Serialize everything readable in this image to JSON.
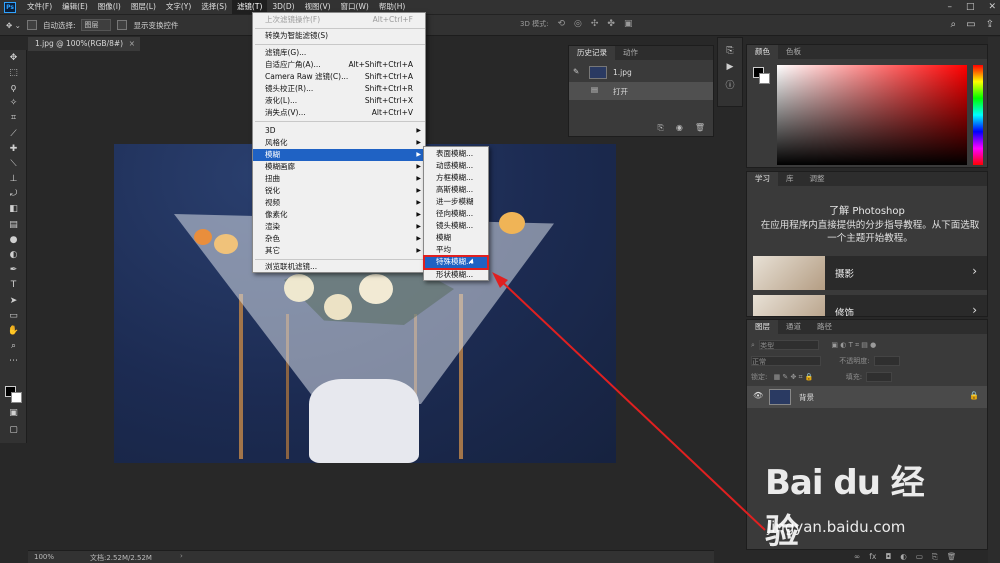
{
  "menubar": {
    "logo": "Ps",
    "items": [
      "文件(F)",
      "编辑(E)",
      "图像(I)",
      "图层(L)",
      "文字(Y)",
      "选择(S)",
      "滤镜(T)",
      "3D(D)",
      "视图(V)",
      "窗口(W)",
      "帮助(H)"
    ],
    "active_index": 6
  },
  "options_bar": {
    "auto_select_label": "自动选择:",
    "auto_select_value": "图层",
    "show_transform_label": "显示变换控件",
    "mode_3d_label": "3D 模式:"
  },
  "document_tab": {
    "title": "1.jpg @ 100%(RGB/8#)",
    "close": "×"
  },
  "filter_menu": {
    "items": [
      {
        "label": "上次滤镜操作(F)",
        "shortcut": "Alt+Ctrl+F",
        "disabled": true
      },
      {
        "label": "转换为智能滤镜(S)",
        "shortcut": ""
      },
      {
        "label": "滤镜库(G)...",
        "shortcut": ""
      },
      {
        "label": "自适应广角(A)...",
        "shortcut": "Alt+Shift+Ctrl+A"
      },
      {
        "label": "Camera Raw 滤镜(C)...",
        "shortcut": "Shift+Ctrl+A"
      },
      {
        "label": "镜头校正(R)...",
        "shortcut": "Shift+Ctrl+R"
      },
      {
        "label": "液化(L)...",
        "shortcut": "Shift+Ctrl+X"
      },
      {
        "label": "消失点(V)...",
        "shortcut": "Alt+Ctrl+V"
      },
      {
        "label": "3D",
        "submenu": true
      },
      {
        "label": "风格化",
        "submenu": true
      },
      {
        "label": "模糊",
        "submenu": true,
        "highlighted": true
      },
      {
        "label": "模糊画廊",
        "submenu": true
      },
      {
        "label": "扭曲",
        "submenu": true
      },
      {
        "label": "锐化",
        "submenu": true
      },
      {
        "label": "视频",
        "submenu": true
      },
      {
        "label": "像素化",
        "submenu": true
      },
      {
        "label": "渲染",
        "submenu": true
      },
      {
        "label": "杂色",
        "submenu": true
      },
      {
        "label": "其它",
        "submenu": true
      },
      {
        "label": "浏览联机滤镜...",
        "shortcut": ""
      }
    ]
  },
  "blur_submenu": {
    "items": [
      "表面模糊...",
      "动感模糊...",
      "方框模糊...",
      "高斯模糊...",
      "进一步模糊",
      "径向模糊...",
      "镜头模糊...",
      "模糊",
      "平均",
      "特殊模糊...",
      "形状模糊..."
    ],
    "selected_index": 9
  },
  "history_panel": {
    "tabs": [
      "历史记录",
      "动作"
    ],
    "rows": [
      {
        "label": "1.jpg"
      },
      {
        "label": "打开"
      }
    ]
  },
  "color_panel": {
    "tabs": [
      "颜色",
      "色板"
    ]
  },
  "learn_panel": {
    "tabs": [
      "学习",
      "库",
      "调整"
    ],
    "title": "了解 Photoshop",
    "description": "在应用程序内直接提供的分步指导教程。从下面选取一个主题开始教程。",
    "cards": [
      "摄影",
      "修饰"
    ]
  },
  "layers_panel": {
    "tabs": [
      "图层",
      "通道",
      "路径"
    ],
    "kind_label": "类型",
    "blend_mode": "正常",
    "opacity_label": "不透明度:",
    "lock_label": "锁定:",
    "fill_label": "填充:",
    "layer_name": "背景"
  },
  "status_bar": {
    "zoom": "100%",
    "doc": "文档:2.52M/2.52M"
  },
  "watermark": {
    "logo": "Bai du 经验",
    "url": "jingyan.baidu.com"
  },
  "colors": {
    "highlight": "#1f62c4",
    "annotation": "#e02020"
  }
}
